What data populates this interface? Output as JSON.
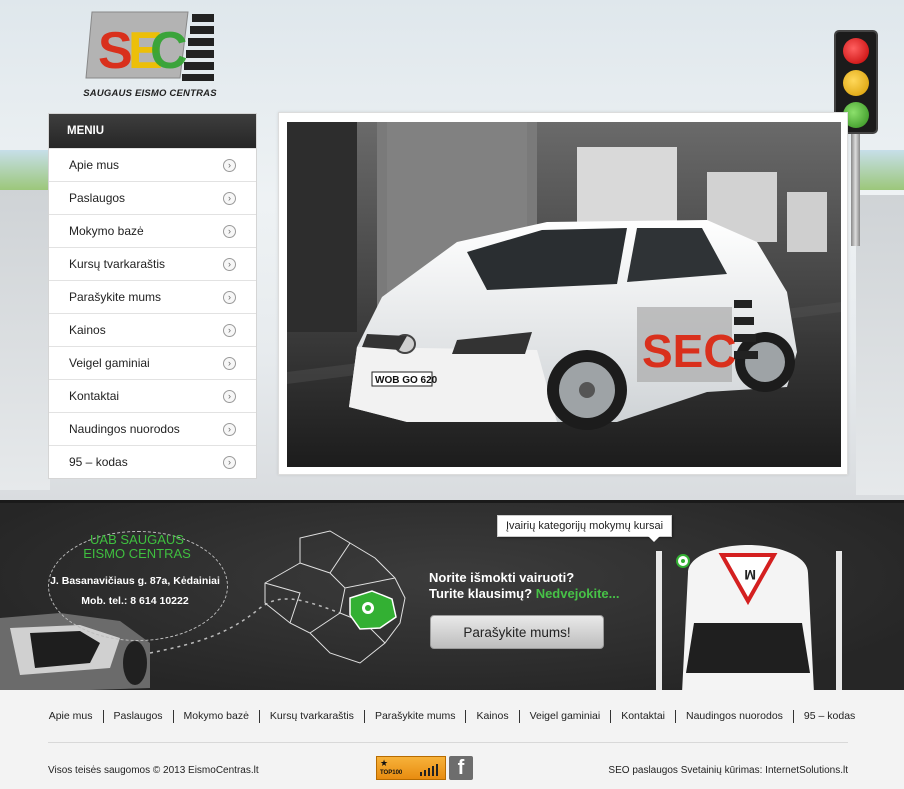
{
  "logo": {
    "letters": "SEC",
    "caption": "SAUGAUS EISMO CENTRAS"
  },
  "menu": {
    "title": "MENIU",
    "items": [
      {
        "label": "Apie mus"
      },
      {
        "label": "Paslaugos"
      },
      {
        "label": "Mokymo bazė"
      },
      {
        "label": "Kursų tvarkaraštis"
      },
      {
        "label": "Parašykite mums"
      },
      {
        "label": "Kainos"
      },
      {
        "label": "Veigel gaminiai"
      },
      {
        "label": "Kontaktai"
      },
      {
        "label": "Naudingos nuorodos"
      },
      {
        "label": "95 – kodas"
      }
    ]
  },
  "hero_photo": {
    "plate": "WOB GO 620",
    "door_logo": "SEC"
  },
  "band": {
    "company_name_line1": "UAB SAUGAUS",
    "company_name_line2": "EISMO CENTRAS",
    "address": "J. Basanavičiaus g. 87a, Kėdainiai",
    "phone": "Mob. tel.: 8 614 10222",
    "question_line1": "Norite išmokti vairuoti?",
    "question_line2_prefix": "Turite klausimų?",
    "question_line2_highlight": "Nedvejokite...",
    "button_label": "Parašykite mums!",
    "bubble_text": "Įvairių kategorijų mokymų kursai",
    "sign_letter": "M"
  },
  "footer": {
    "nav": [
      "Apie mus",
      "Paslaugos",
      "Mokymo bazė",
      "Kursų tvarkaraštis",
      "Parašykite mums",
      "Kainos",
      "Veigel gaminiai",
      "Kontaktai",
      "Naudingos nuorodos",
      "95 – kodas"
    ],
    "copyright": "Visos teisės saugomos © 2013 EismoCentras.lt",
    "credits": "SEO paslaugos Svetainių kūrimas: InternetSolutions.lt",
    "top100_label": "TOP100",
    "facebook_glyph": "f"
  },
  "colors": {
    "accent_green": "#47c247",
    "dark_band": "#2e2e2e",
    "menu_header": "#333333"
  }
}
